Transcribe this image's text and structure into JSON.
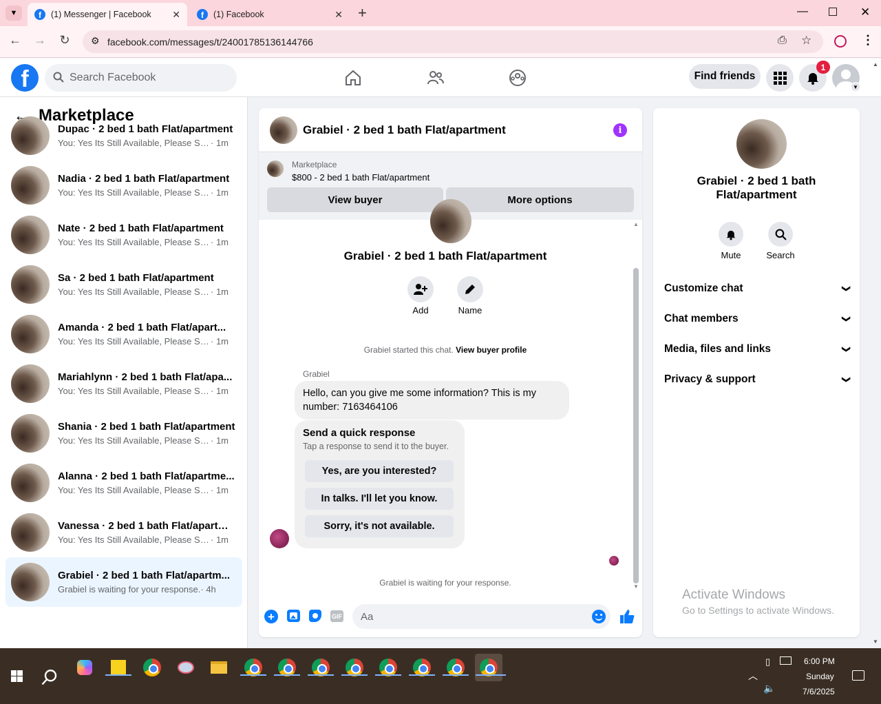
{
  "browser": {
    "tabs": [
      {
        "title": "(1) Messenger | Facebook"
      },
      {
        "title": "(1) Facebook"
      }
    ],
    "url": "facebook.com/messages/t/24001785136144766"
  },
  "fb": {
    "logo_letter": "f",
    "search_placeholder": "Search Facebook",
    "find_friends": "Find friends",
    "notif_count": "1"
  },
  "left": {
    "title": "Marketplace",
    "conversations": [
      {
        "name": "Dupac · 2 bed 1 bath Flat/apartment",
        "msg": "You: Yes Its Still Available, Please Sen...",
        "time": "· 1m"
      },
      {
        "name": "Nadia · 2 bed 1 bath Flat/apartment",
        "msg": "You: Yes Its Still Available, Please Sen...",
        "time": "· 1m"
      },
      {
        "name": "Nate · 2 bed 1 bath Flat/apartment",
        "msg": "You: Yes Its Still Available, Please Sen...",
        "time": "· 1m"
      },
      {
        "name": "Sa · 2 bed 1 bath Flat/apartment",
        "msg": "You: Yes Its Still Available, Please Sen...",
        "time": "· 1m"
      },
      {
        "name": "Amanda · 2 bed 1 bath Flat/apart...",
        "msg": "You: Yes Its Still Available, Please Sen...",
        "time": "· 1m"
      },
      {
        "name": "Mariahlynn · 2 bed 1 bath Flat/apa...",
        "msg": "You: Yes Its Still Available, Please Sen...",
        "time": "· 1m"
      },
      {
        "name": "Shania · 2 bed 1 bath Flat/apartment",
        "msg": "You: Yes Its Still Available, Please Sen...",
        "time": "· 1m"
      },
      {
        "name": "Alanna · 2 bed 1 bath Flat/apartme...",
        "msg": "You: Yes Its Still Available, Please Sen...",
        "time": "· 1m"
      },
      {
        "name": "Vanessa · 2 bed 1 bath Flat/apartm...",
        "msg": "You: Yes Its Still Available, Please Sen...",
        "time": "· 1m"
      },
      {
        "name": "Grabiel · 2 bed 1 bath Flat/apartm...",
        "msg": "Grabiel is waiting for your response.",
        "time": "· 4h"
      }
    ]
  },
  "chat": {
    "header_title": "Grabiel · 2 bed 1 bath Flat/apartment",
    "mp_label": "Marketplace",
    "mp_listing": "$800 - 2 bed 1 bath Flat/apartment",
    "view_buyer": "View buyer",
    "more_options": "More options",
    "profile_name": "Grabiel · 2 bed 1 bath Flat/apartment",
    "add_label": "Add",
    "name_label": "Name",
    "started_text": "Grabiel started this chat.",
    "view_buyer_profile": "View buyer profile",
    "sender": "Grabiel",
    "message": "Hello, can you give me some information? This is my number: 7163464106",
    "quick_title": "Send a quick response",
    "quick_sub": "Tap a response to send it to the buyer.",
    "quick_responses": [
      "Yes, are you interested?",
      "In talks. I'll let you know.",
      "Sorry, it's not available."
    ],
    "waiting": "Grabiel is waiting for your response.",
    "input_placeholder": "Aa"
  },
  "right": {
    "name": "Grabiel · 2 bed 1 bath Flat/apartment",
    "mute": "Mute",
    "search": "Search",
    "rows": [
      "Customize chat",
      "Chat members",
      "Media, files and links",
      "Privacy & support"
    ],
    "watermark_title": "Activate Windows",
    "watermark_sub": "Go to Settings to activate Windows."
  },
  "taskbar": {
    "time": "6:00 PM",
    "day": "Sunday",
    "date": "7/6/2025"
  },
  "colors": {
    "fb_blue": "#1877f2",
    "messenger_purple": "#a033ff",
    "tab_pink": "#fbd6dc"
  }
}
